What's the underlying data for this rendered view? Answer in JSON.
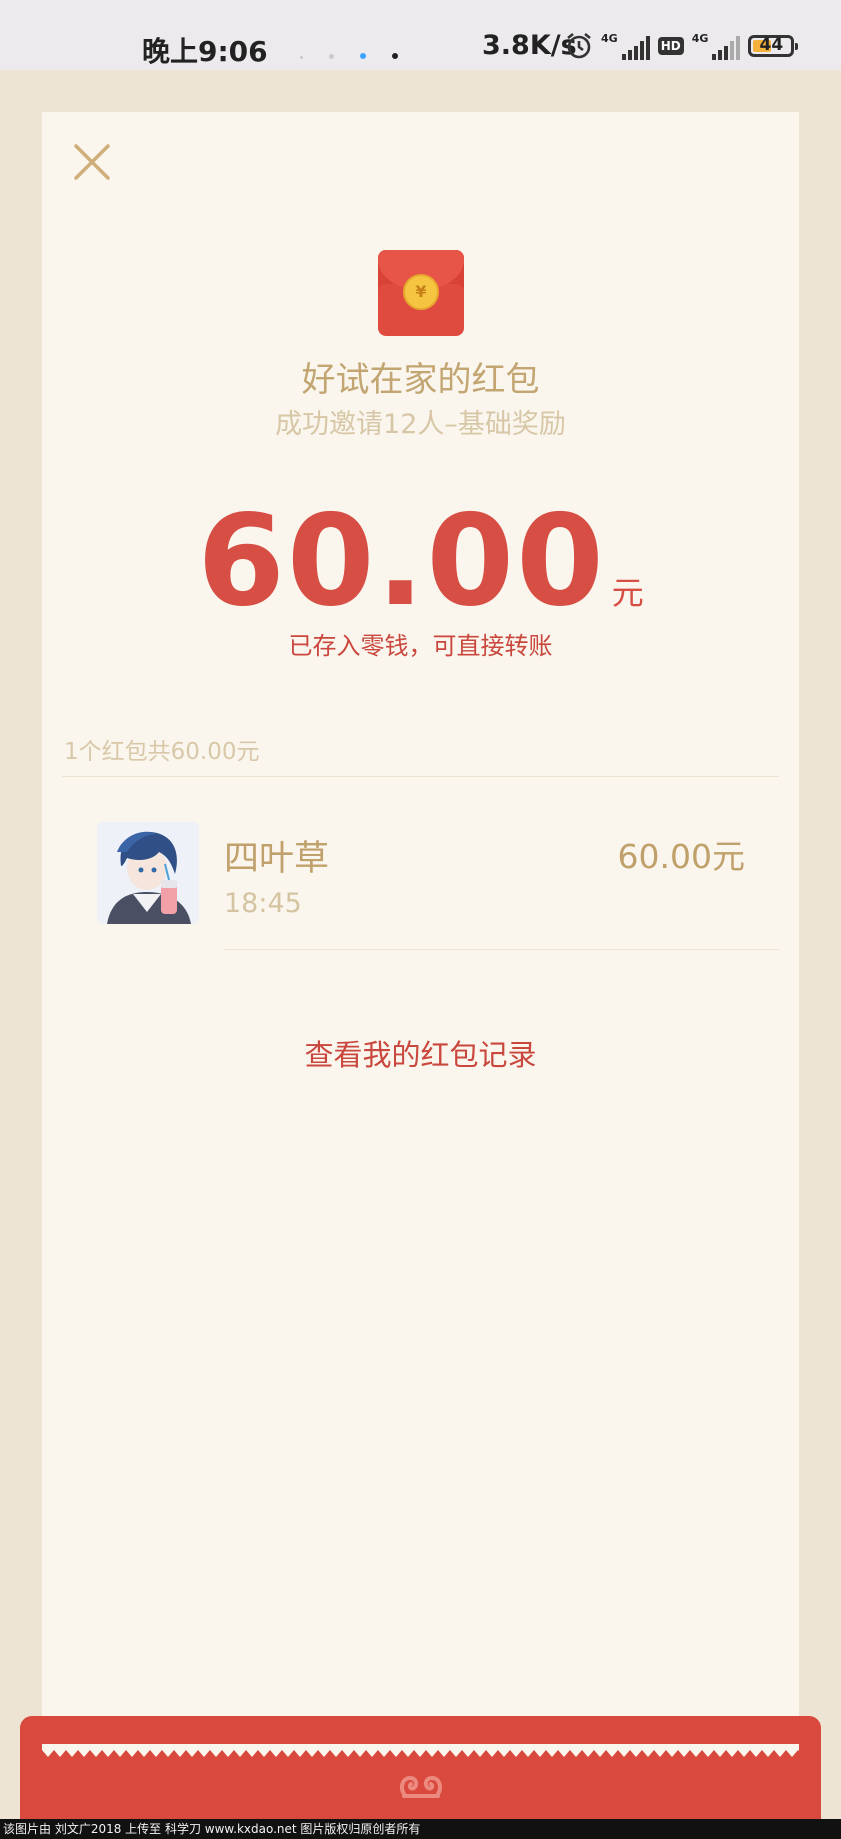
{
  "status_bar": {
    "time": "晚上9:06",
    "net_speed": "3.8K/s",
    "network1": "4G",
    "hd": "HD",
    "network2": "4G",
    "battery": "44"
  },
  "packet": {
    "title": "好试在家的红包",
    "subtitle": "成功邀请12人–基础奖励",
    "amount": "60.00",
    "unit": "元",
    "note": "已存入零钱，可直接转账",
    "summary": "1个红包共60.00元",
    "records_link": "查看我的红包记录"
  },
  "recipients": [
    {
      "name": "四叶草",
      "time": "18:45",
      "amount": "60.00元"
    }
  ],
  "watermark": "该图片由 刘文广2018 上传至 科学刀 www.kxdao.net 图片版权归原创者所有",
  "colors": {
    "accent_red": "#d64e44",
    "gold_text": "#c0a06b",
    "card_bg": "#faf6ee",
    "page_bg": "#ede4d3"
  },
  "icons": {
    "close": "close-icon",
    "envelope": "red-envelope-icon",
    "alarm": "alarm-icon",
    "emblem": "cloud-emblem-icon"
  }
}
